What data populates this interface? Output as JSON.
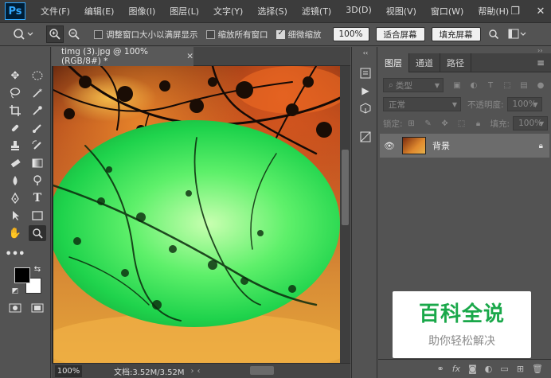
{
  "app": {
    "logo": "Ps",
    "menus": [
      "文件(F)",
      "编辑(E)",
      "图像(I)",
      "图层(L)",
      "文字(Y)",
      "选择(S)",
      "滤镜(T)",
      "3D(D)",
      "视图(V)",
      "窗口(W)",
      "帮助(H)"
    ],
    "window_controls": [
      "minimize-icon",
      "restore-icon",
      "close-icon"
    ]
  },
  "options": {
    "resize_windows_label": "调整窗口大小以满屏显示",
    "resize_windows_checked": false,
    "zoom_all_label": "缩放所有窗口",
    "zoom_all_checked": false,
    "scrubby_zoom_label": "细微缩放",
    "scrubby_zoom_checked": true,
    "zoom_100_button": "100%",
    "fit_screen_button": "适合屏幕",
    "fill_screen_button": "填充屏幕"
  },
  "document": {
    "tab_title": "timg (3).jpg @ 100%(RGB/8#) *",
    "zoom_value": "100%",
    "doc_info": "文档:3.52M/3.52M"
  },
  "layers_panel": {
    "tabs": [
      "图层",
      "通道",
      "路径"
    ],
    "active_tab": 0,
    "filter_kind": "类型",
    "blend_mode": "正常",
    "opacity_label": "不透明度:",
    "opacity_value": "100%",
    "lock_label": "锁定:",
    "fill_label": "填充:",
    "fill_value": "100%",
    "layers": [
      {
        "name": "背景",
        "visible": true,
        "locked": true
      }
    ]
  },
  "watermark": {
    "title": "百科全说",
    "subtitle": "助你轻松解决"
  },
  "colors": {
    "menubar": "#3c3c3c",
    "panel": "#535353",
    "selection_green": "#1fd34c",
    "watermark_green": "#1aa84a"
  }
}
